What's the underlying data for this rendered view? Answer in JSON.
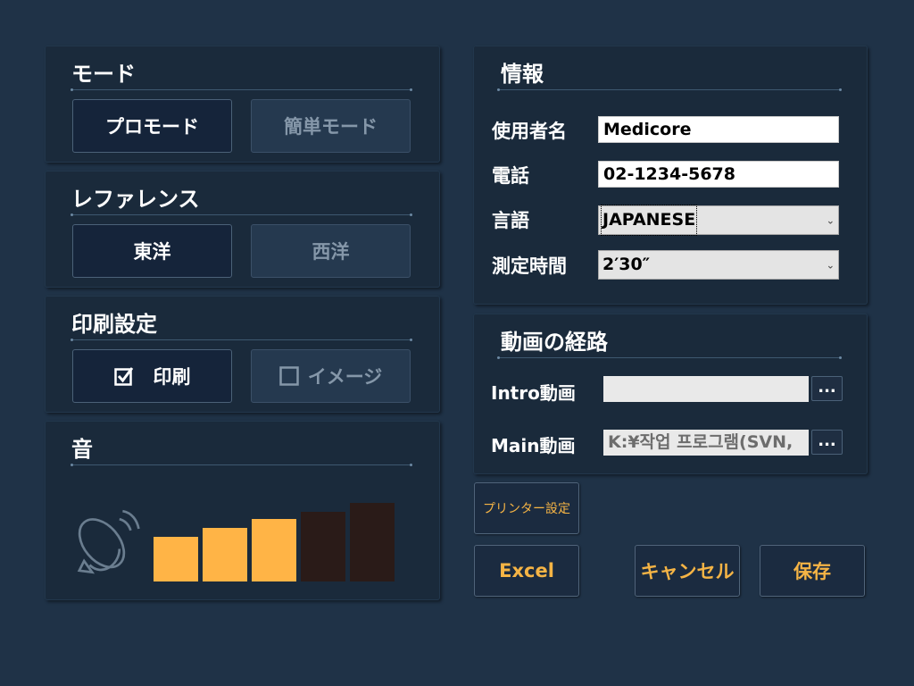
{
  "mode": {
    "title": "モード",
    "pro_label": "プロモード",
    "simple_label": "簡単モード"
  },
  "reference": {
    "title": "レファレンス",
    "eastern_label": "東洋",
    "western_label": "西洋"
  },
  "print_settings": {
    "title": "印刷設定",
    "print_label": "印刷",
    "print_checked": true,
    "image_label": "イメージ",
    "image_checked": false
  },
  "sound": {
    "title": "音",
    "icon": "speaker-icon",
    "volume_level": 3,
    "volume_max": 5,
    "active_color": "#ffb446",
    "inactive_color": "#2a1b18"
  },
  "info": {
    "title": "情報",
    "user_label": "使用者名",
    "user_value": "Medicore",
    "phone_label": "電話",
    "phone_value": "02-1234-5678",
    "language_label": "言語",
    "language_value": "JAPANESE",
    "time_label": "測定時間",
    "time_value": "2′30″"
  },
  "video_path": {
    "title": "動画の経路",
    "intro_label": "Intro動画",
    "intro_value": "",
    "main_label": "Main動画",
    "main_value": "K:¥작업 프로그램(SVN,",
    "browse_label": "..."
  },
  "actions": {
    "printer_settings": "プリンター設定",
    "excel": "Excel",
    "cancel": "キャンセル",
    "save": "保存"
  },
  "colors": {
    "background": "#1f3247",
    "panel": "#1a2a3b",
    "accent": "#f5b445"
  }
}
